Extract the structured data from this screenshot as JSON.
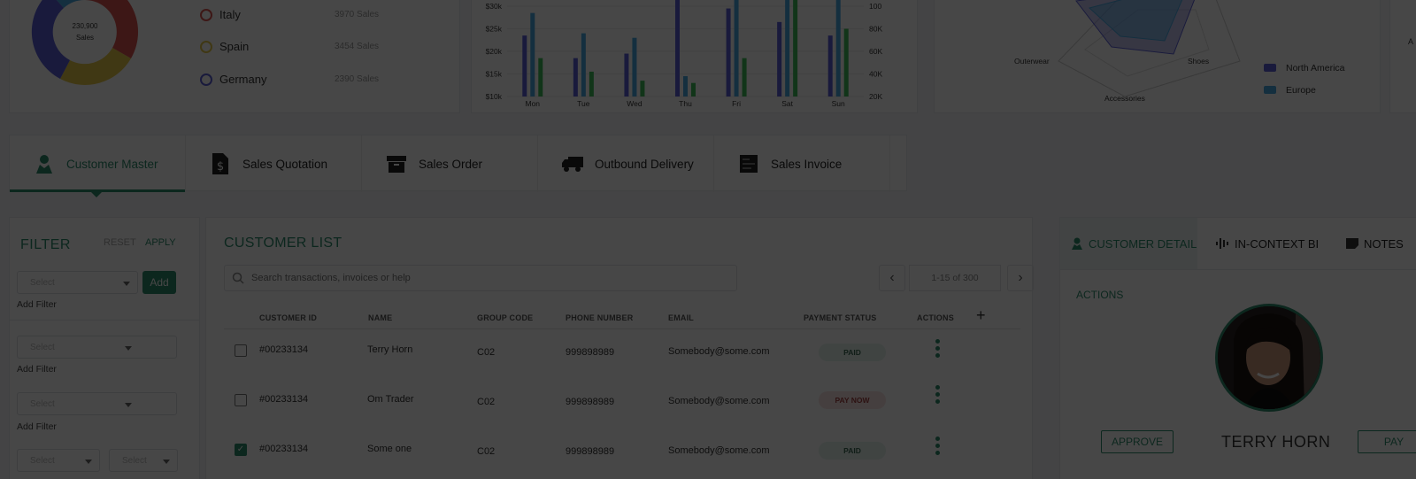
{
  "donut": {
    "center_value": "230,900",
    "center_label": "Sales",
    "legend": [
      {
        "name": "Italy",
        "value": "3970 Sales",
        "color": "#d9534f"
      },
      {
        "name": "Spain",
        "value": "3454 Sales",
        "color": "#e6c84a"
      },
      {
        "name": "Germany",
        "value": "2390 Sales",
        "color": "#5b5fd6"
      }
    ],
    "segment_colors": [
      "#d9534f",
      "#e6c84a",
      "#5b5fd6",
      "#4aa8e0"
    ]
  },
  "bar_chart": {
    "left_ticks": [
      "$30k",
      "$25k",
      "$20k",
      "$15k",
      "$10k"
    ],
    "right_ticks": [
      "100",
      "80K",
      "60K",
      "40K",
      "20K"
    ],
    "colors": {
      "series1": "#5b5fd6",
      "series2": "#4aa8e0",
      "series3": "#3fbf5a"
    }
  },
  "chart_data": {
    "type": "bar",
    "categories": [
      "Mon",
      "Tue",
      "Wed",
      "Thu",
      "Fri",
      "Sat",
      "Sun"
    ],
    "series": [
      {
        "values": [
          23.5,
          18.5,
          19.5,
          30.5,
          29.5,
          26.5,
          23.5
        ]
      },
      {
        "values": [
          28.5,
          24,
          23,
          14.5,
          31,
          31,
          31
        ]
      },
      {
        "values": [
          18.5,
          15.5,
          13.5,
          13,
          18.5,
          30,
          25
        ]
      }
    ],
    "ylim": [
      10,
      30
    ],
    "left_ticks": [
      "$30k",
      "$25k",
      "$20k",
      "$15k",
      "$10k"
    ],
    "right_ticks": [
      "100",
      "80K",
      "60K",
      "40K",
      "20K"
    ]
  },
  "radar": {
    "labels": {
      "left": "Outerwear",
      "right": "Shoes",
      "bottom": "Accessories"
    },
    "legend": [
      {
        "name": "North America",
        "color": "#5b5fd6"
      },
      {
        "name": "Europe",
        "color": "#4aa8e0"
      }
    ],
    "right_stub_text": "A"
  },
  "tabs": [
    {
      "label": "Customer Master",
      "icon": "person-icon",
      "active": true
    },
    {
      "label": "Sales Quotation",
      "icon": "dollar-document-icon",
      "active": false
    },
    {
      "label": "Sales Order",
      "icon": "archive-box-icon",
      "active": false
    },
    {
      "label": "Outbound Delivery",
      "icon": "truck-icon",
      "active": false
    },
    {
      "label": "Sales Invoice",
      "icon": "invoice-icon",
      "active": false
    }
  ],
  "filter": {
    "title": "FILTER",
    "reset": "RESET",
    "apply": "APPLY",
    "select_placeholder": "Select",
    "add_button": "Add",
    "add_filter": "Add Filter"
  },
  "customer_list": {
    "title": "CUSTOMER LIST",
    "search_placeholder": "Search transactions, invoices or help",
    "pagination": "1-15 of 300",
    "columns": [
      "CUSTOMER ID",
      "NAME",
      "GROUP CODE",
      "PHONE NUMBER",
      "EMAIL",
      "PAYMENT STATUS",
      "ACTIONS"
    ],
    "rows": [
      {
        "id": "#00233134",
        "name": "Terry Horn",
        "group": "C02",
        "phone": "999898989",
        "email": "Somebody@some.com",
        "status": "PAID",
        "checked": false
      },
      {
        "id": "#00233134",
        "name": "Om Trader",
        "group": "C02",
        "phone": "999898989",
        "email": "Somebody@some.com",
        "status": "PAY NOW",
        "checked": false
      },
      {
        "id": "#00233134",
        "name": "Some one",
        "group": "C02",
        "phone": "999898989",
        "email": "Somebody@some.com",
        "status": "PAID",
        "checked": true
      }
    ]
  },
  "detail": {
    "tabs": [
      "CUSTOMER DETAIL",
      "IN-CONTEXT BI",
      "NOTES"
    ],
    "actions_label": "ACTIONS",
    "name": "TERRY HORN",
    "approve": "APPROVE",
    "pay": "PAY"
  },
  "theme": {
    "accent": "#2e8b6d"
  }
}
